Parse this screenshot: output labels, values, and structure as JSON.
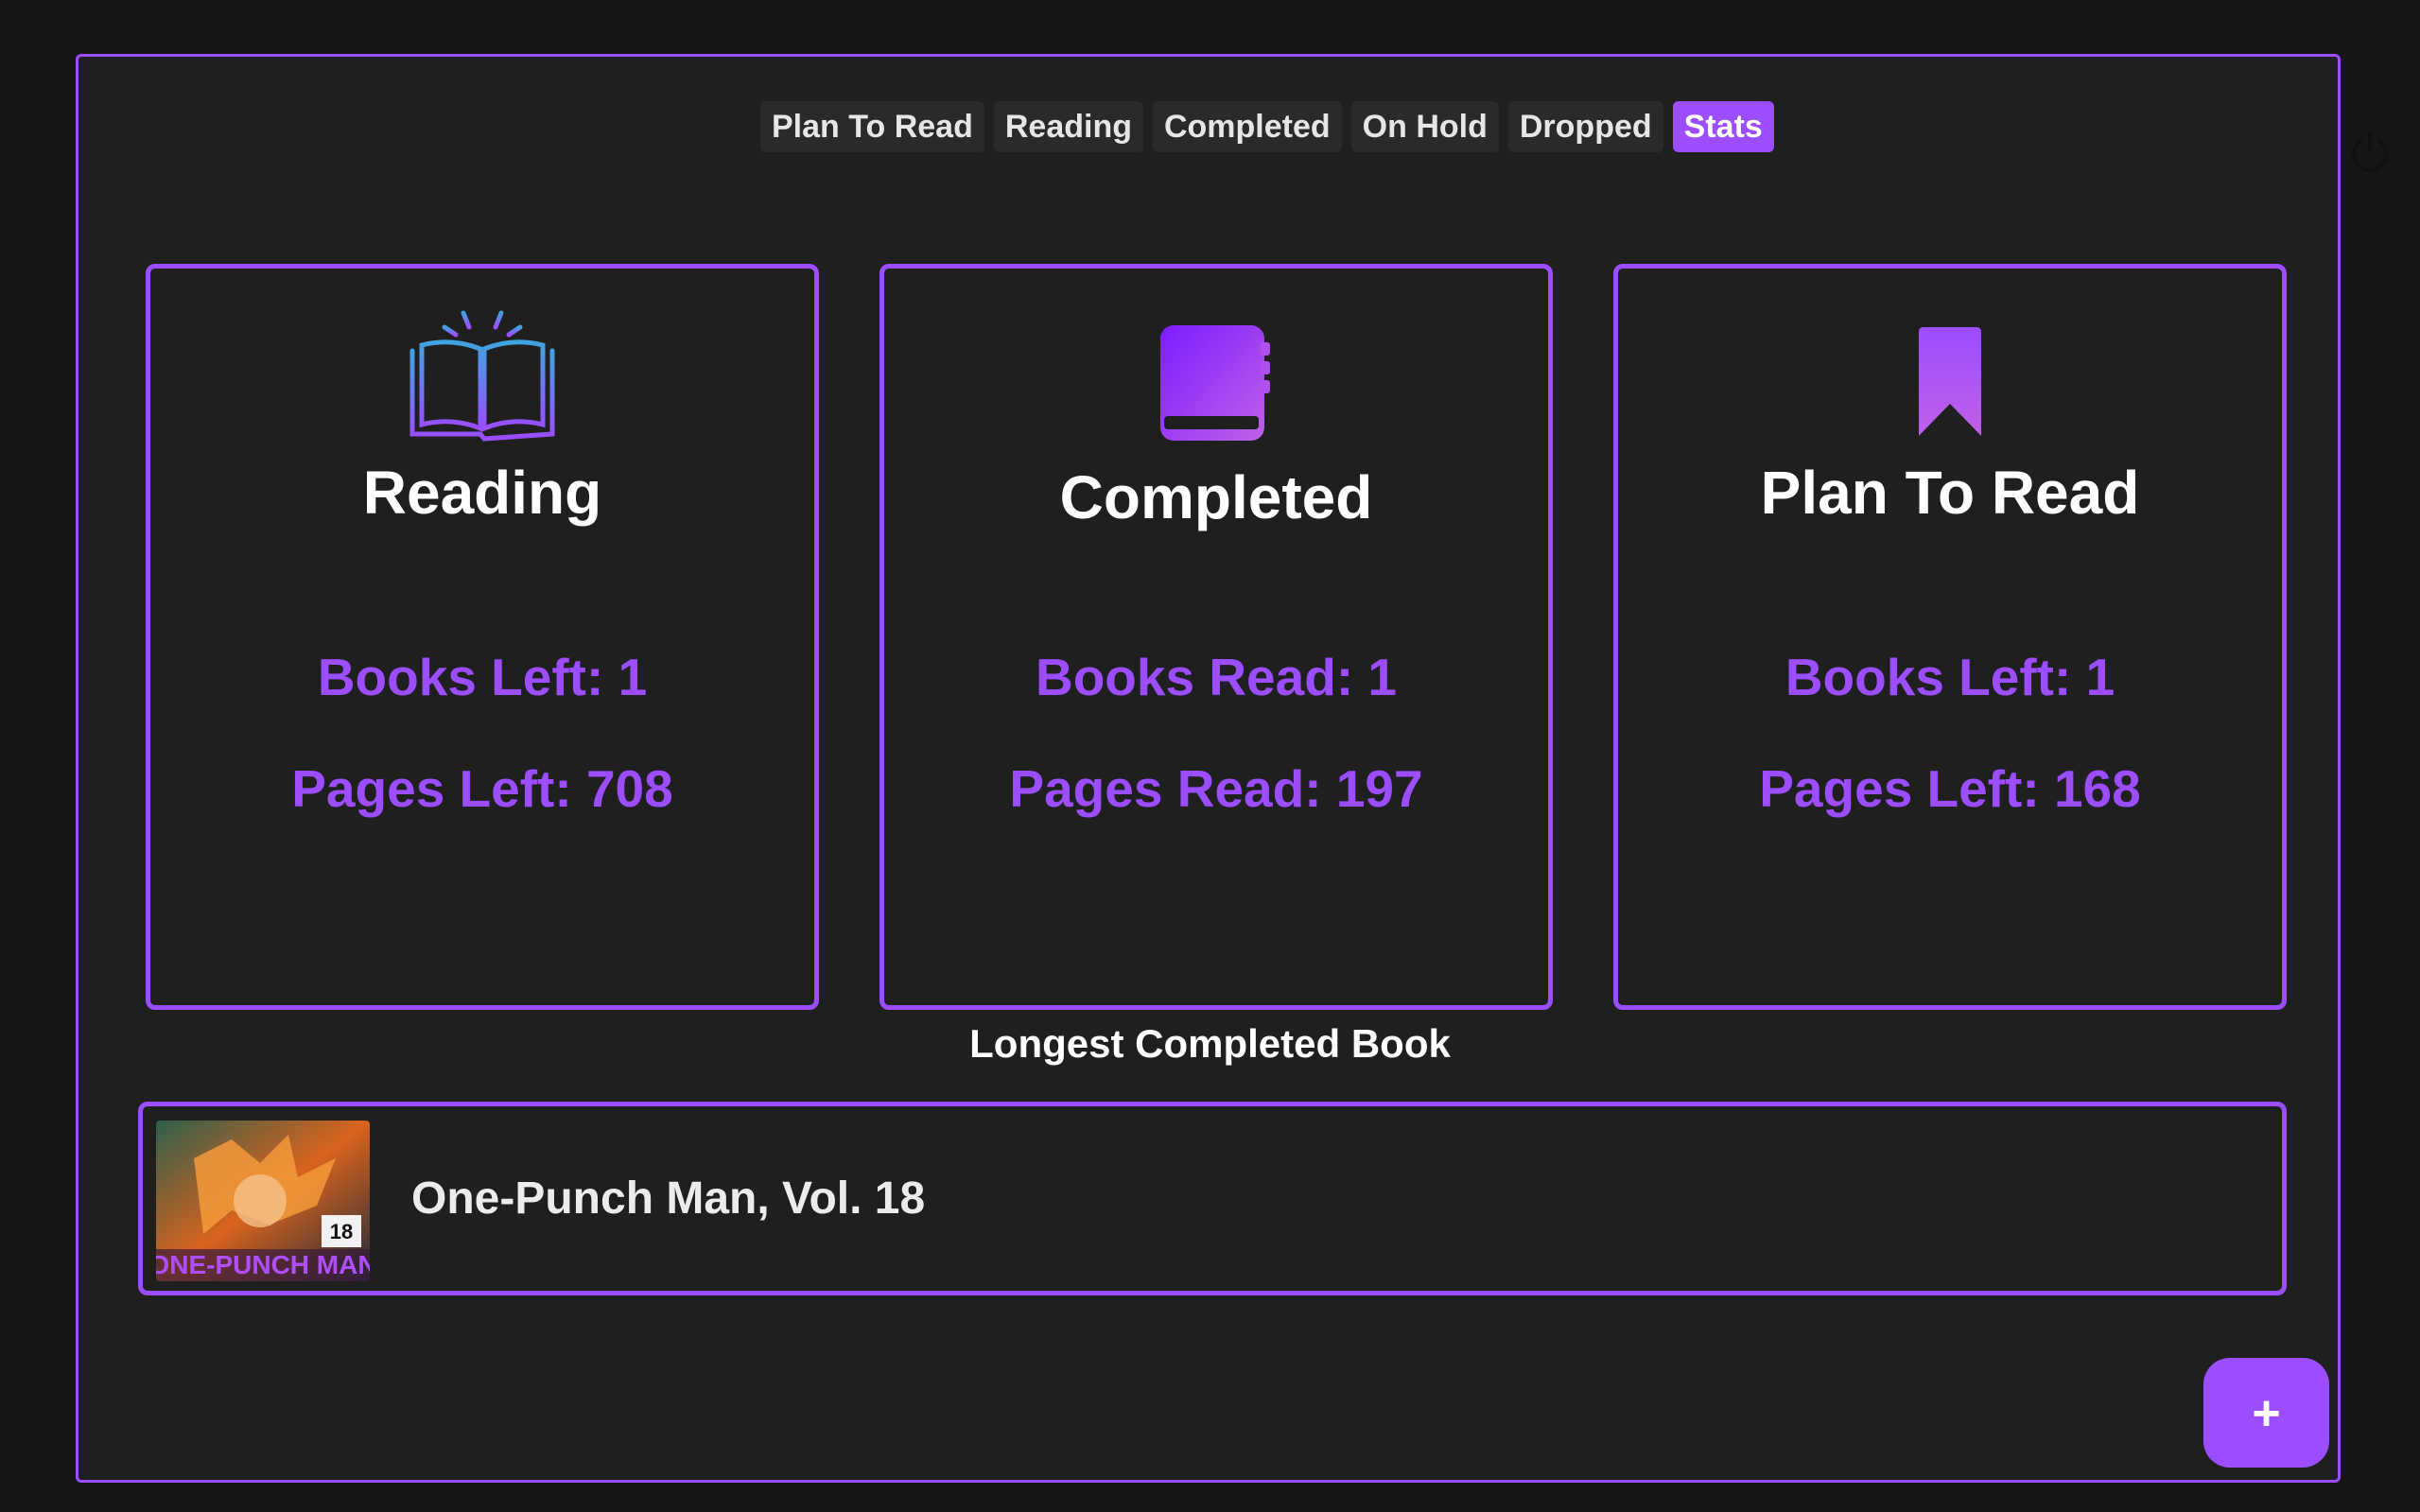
{
  "tabs": [
    {
      "label": "Plan To Read",
      "active": false
    },
    {
      "label": "Reading",
      "active": false
    },
    {
      "label": "Completed",
      "active": false
    },
    {
      "label": "On Hold",
      "active": false
    },
    {
      "label": "Dropped",
      "active": false
    },
    {
      "label": "Stats",
      "active": true
    }
  ],
  "header": {
    "power_icon": "power-icon"
  },
  "cards": [
    {
      "icon": "open-book-icon",
      "title": "Reading",
      "stat1": "Books Left: 1",
      "stat2": "Pages Left: 708"
    },
    {
      "icon": "closed-book-icon",
      "title": "Completed",
      "stat1": "Books Read: 1",
      "stat2": "Pages Read: 197"
    },
    {
      "icon": "bookmark-icon",
      "title": "Plan To Read",
      "stat1": "Books Left: 1",
      "stat2": "Pages Left: 168"
    }
  ],
  "longest": {
    "title": "Longest Completed Book",
    "book": {
      "name": "One-Punch Man, Vol. 18",
      "cover_text": "ONE-PUNCH MAN",
      "volume": "18"
    }
  },
  "fab": {
    "label": "+"
  },
  "colors": {
    "accent": "#9b4dff",
    "background": "#1f1f1f",
    "page_background": "#161616"
  }
}
